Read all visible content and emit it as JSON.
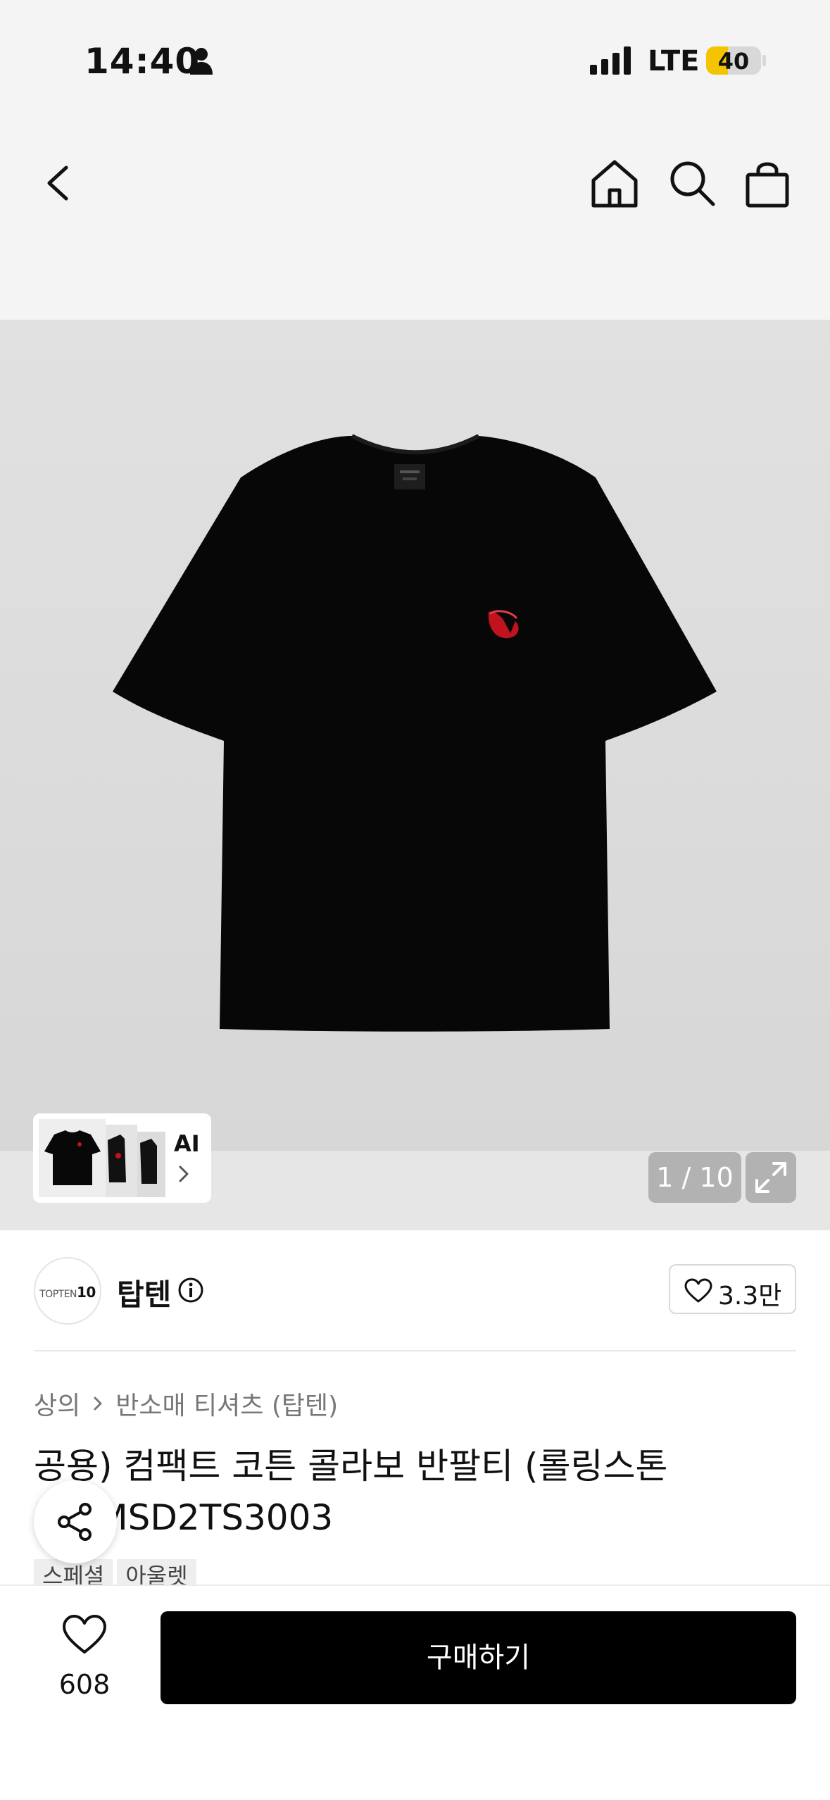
{
  "status_bar": {
    "time": "14:40",
    "network": "LTE",
    "battery_percent": "40",
    "battery_level": 0.4,
    "icons": [
      "person-icon",
      "signal-icon",
      "battery-icon"
    ],
    "battery_color": "#f5c400"
  },
  "nav": {
    "icons": [
      "chevron-left-icon",
      "home-icon",
      "search-icon",
      "shopping-bag-icon"
    ]
  },
  "gallery": {
    "counter": "1 / 10",
    "ai_label": "AI",
    "icons": [
      "expand-icon",
      "chevron-right-icon"
    ]
  },
  "brand": {
    "logo_text": "TOPTEN",
    "logo_number": "10",
    "name": "탑텐",
    "like_count": "3.3만",
    "icons": [
      "info-icon",
      "heart-outline-icon"
    ]
  },
  "breadcrumb": [
    "상의",
    "반소매 티셔츠 (탑텐)"
  ],
  "product": {
    "title": "공용) 컴팩트 코튼 콜라보 반팔티 (롤링스톤즈)_MSD2TS3003",
    "tags": [
      "스페셜",
      "아울렛"
    ]
  },
  "bottom_bar": {
    "wish_count": "608",
    "buy_label": "구매하기",
    "button_color": "#000000"
  }
}
